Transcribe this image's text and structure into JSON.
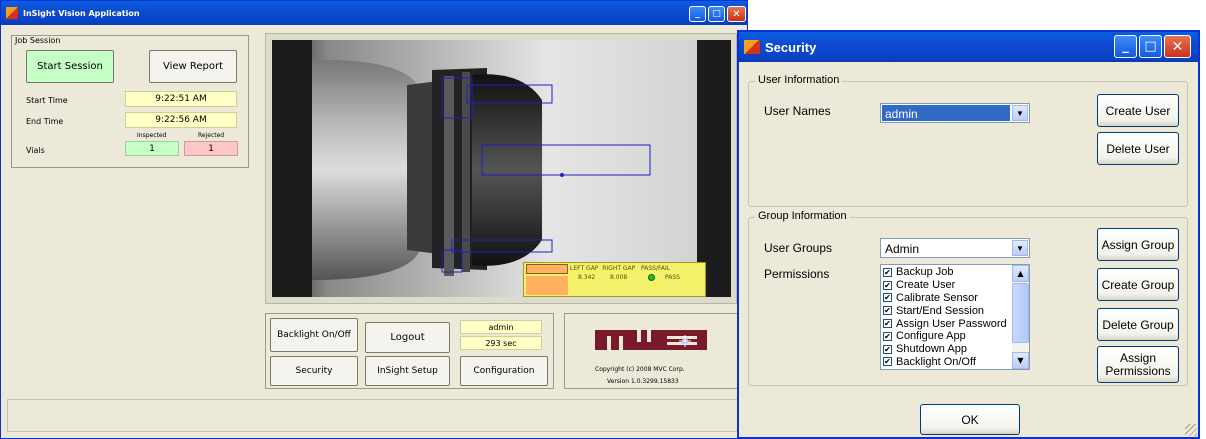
{
  "main": {
    "title": "InSight Vision Application",
    "job": {
      "legend": "Job Session",
      "start_btn": "Start Session",
      "view_btn": "View Report",
      "start_lbl": "Start Time",
      "start_val": "9:22:51 AM",
      "end_lbl": "End Time",
      "end_val": "9:22:56 AM",
      "inspected_hdr": "Inspected",
      "rejected_hdr": "Rejected",
      "vials_lbl": "Vials",
      "inspected": "1",
      "rejected": "1"
    },
    "overlay": {
      "hdr": "LEFT GAP  RIGHT GAP   PASS/FAIL",
      "left": "8.342",
      "right": "8.008",
      "status": "PASS"
    },
    "controls": {
      "backlight": "Backlight On/Off",
      "logout": "Logout",
      "user": "admin",
      "timer": "293 sec",
      "security": "Security",
      "setup": "InSight Setup",
      "config": "Configuration"
    },
    "logo": {
      "text": "mvc",
      "copyright": "Copyright (c) 2008 MVC Corp.",
      "version": "Version 1.0.3299.15833"
    }
  },
  "security": {
    "title": "Security",
    "user_info": {
      "legend": "User Information",
      "names_lbl": "User Names",
      "selected": "admin",
      "create": "Create User",
      "delete": "Delete User"
    },
    "group_info": {
      "legend": "Group Information",
      "groups_lbl": "User Groups",
      "selected": "Admin",
      "perm_lbl": "Permissions",
      "permissions": [
        "Backup Job",
        "Create User",
        "Calibrate Sensor",
        "Start/End Session",
        "Assign User Password",
        "Configure App",
        "Shutdown App",
        "Backlight On/Off"
      ],
      "assign": "Assign Group",
      "create": "Create Group",
      "delete": "Delete Group",
      "assign_perm": "Assign Permissions"
    },
    "ok": "OK"
  },
  "colors": {
    "title_blue": "#0a5fe0",
    "selection": "#316ac5",
    "green_btn": "#c6ffc6",
    "yellow_field": "#ffffc6",
    "red_field": "#ffc6c6"
  }
}
